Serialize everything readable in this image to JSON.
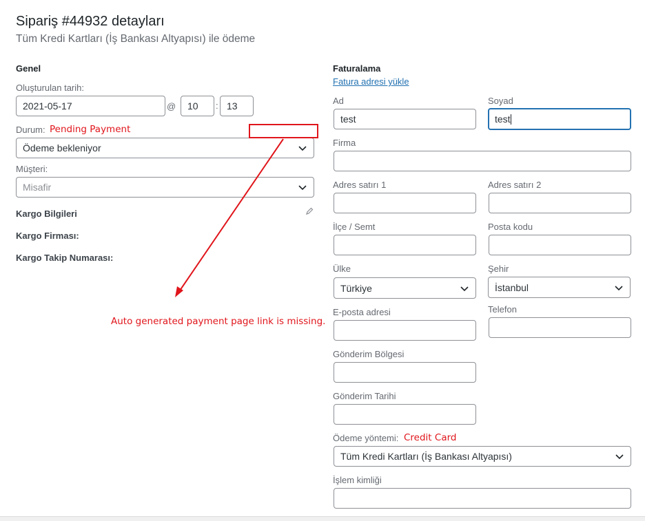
{
  "header": {
    "title": "Sipariş #44932 detayları",
    "subtitle": "Tüm Kredi Kartları (İş Bankası Altyapısı) ile ödeme"
  },
  "general": {
    "heading": "Genel",
    "created_label": "Oluşturulan tarih:",
    "created_date": "2021-05-17",
    "at_symbol": "@",
    "hour": "10",
    "colon": ":",
    "minute": "13",
    "status_label": "Durum:",
    "status_value": "Ödeme bekleniyor",
    "customer_label": "Müşteri:",
    "customer_placeholder": "Misafir"
  },
  "shipping": {
    "heading": "Kargo Bilgileri",
    "company_label": "Kargo Firması:",
    "tracking_label": "Kargo Takip Numarası:"
  },
  "billing": {
    "heading": "Faturalama",
    "load_link": "Fatura adresi yükle",
    "first_name_label": "Ad",
    "first_name": "test",
    "last_name_label": "Soyad",
    "last_name": "test",
    "company_label": "Firma",
    "address1_label": "Adres satırı 1",
    "address2_label": "Adres satırı 2",
    "district_label": "İlçe / Semt",
    "postcode_label": "Posta kodu",
    "country_label": "Ülke",
    "country": "Türkiye",
    "city_label": "Şehir",
    "city": "İstanbul",
    "email_label": "E-posta adresi",
    "phone_label": "Telefon",
    "shipping_region_label": "Gönderim Bölgesi",
    "shipping_date_label": "Gönderim Tarihi",
    "payment_method_label": "Ödeme yöntemi:",
    "payment_method": "Tüm Kredi Kartları (İş Bankası Altyapısı)",
    "transaction_id_label": "İşlem kimliği"
  },
  "annotations": {
    "status_note": "Pending Payment",
    "payment_note": "Credit Card",
    "missing_note": "Auto generated payment page link is missing.",
    "color": "#e0151b"
  },
  "icons": {
    "pencil": "pencil-icon",
    "chevron": "chevron-down-icon"
  }
}
